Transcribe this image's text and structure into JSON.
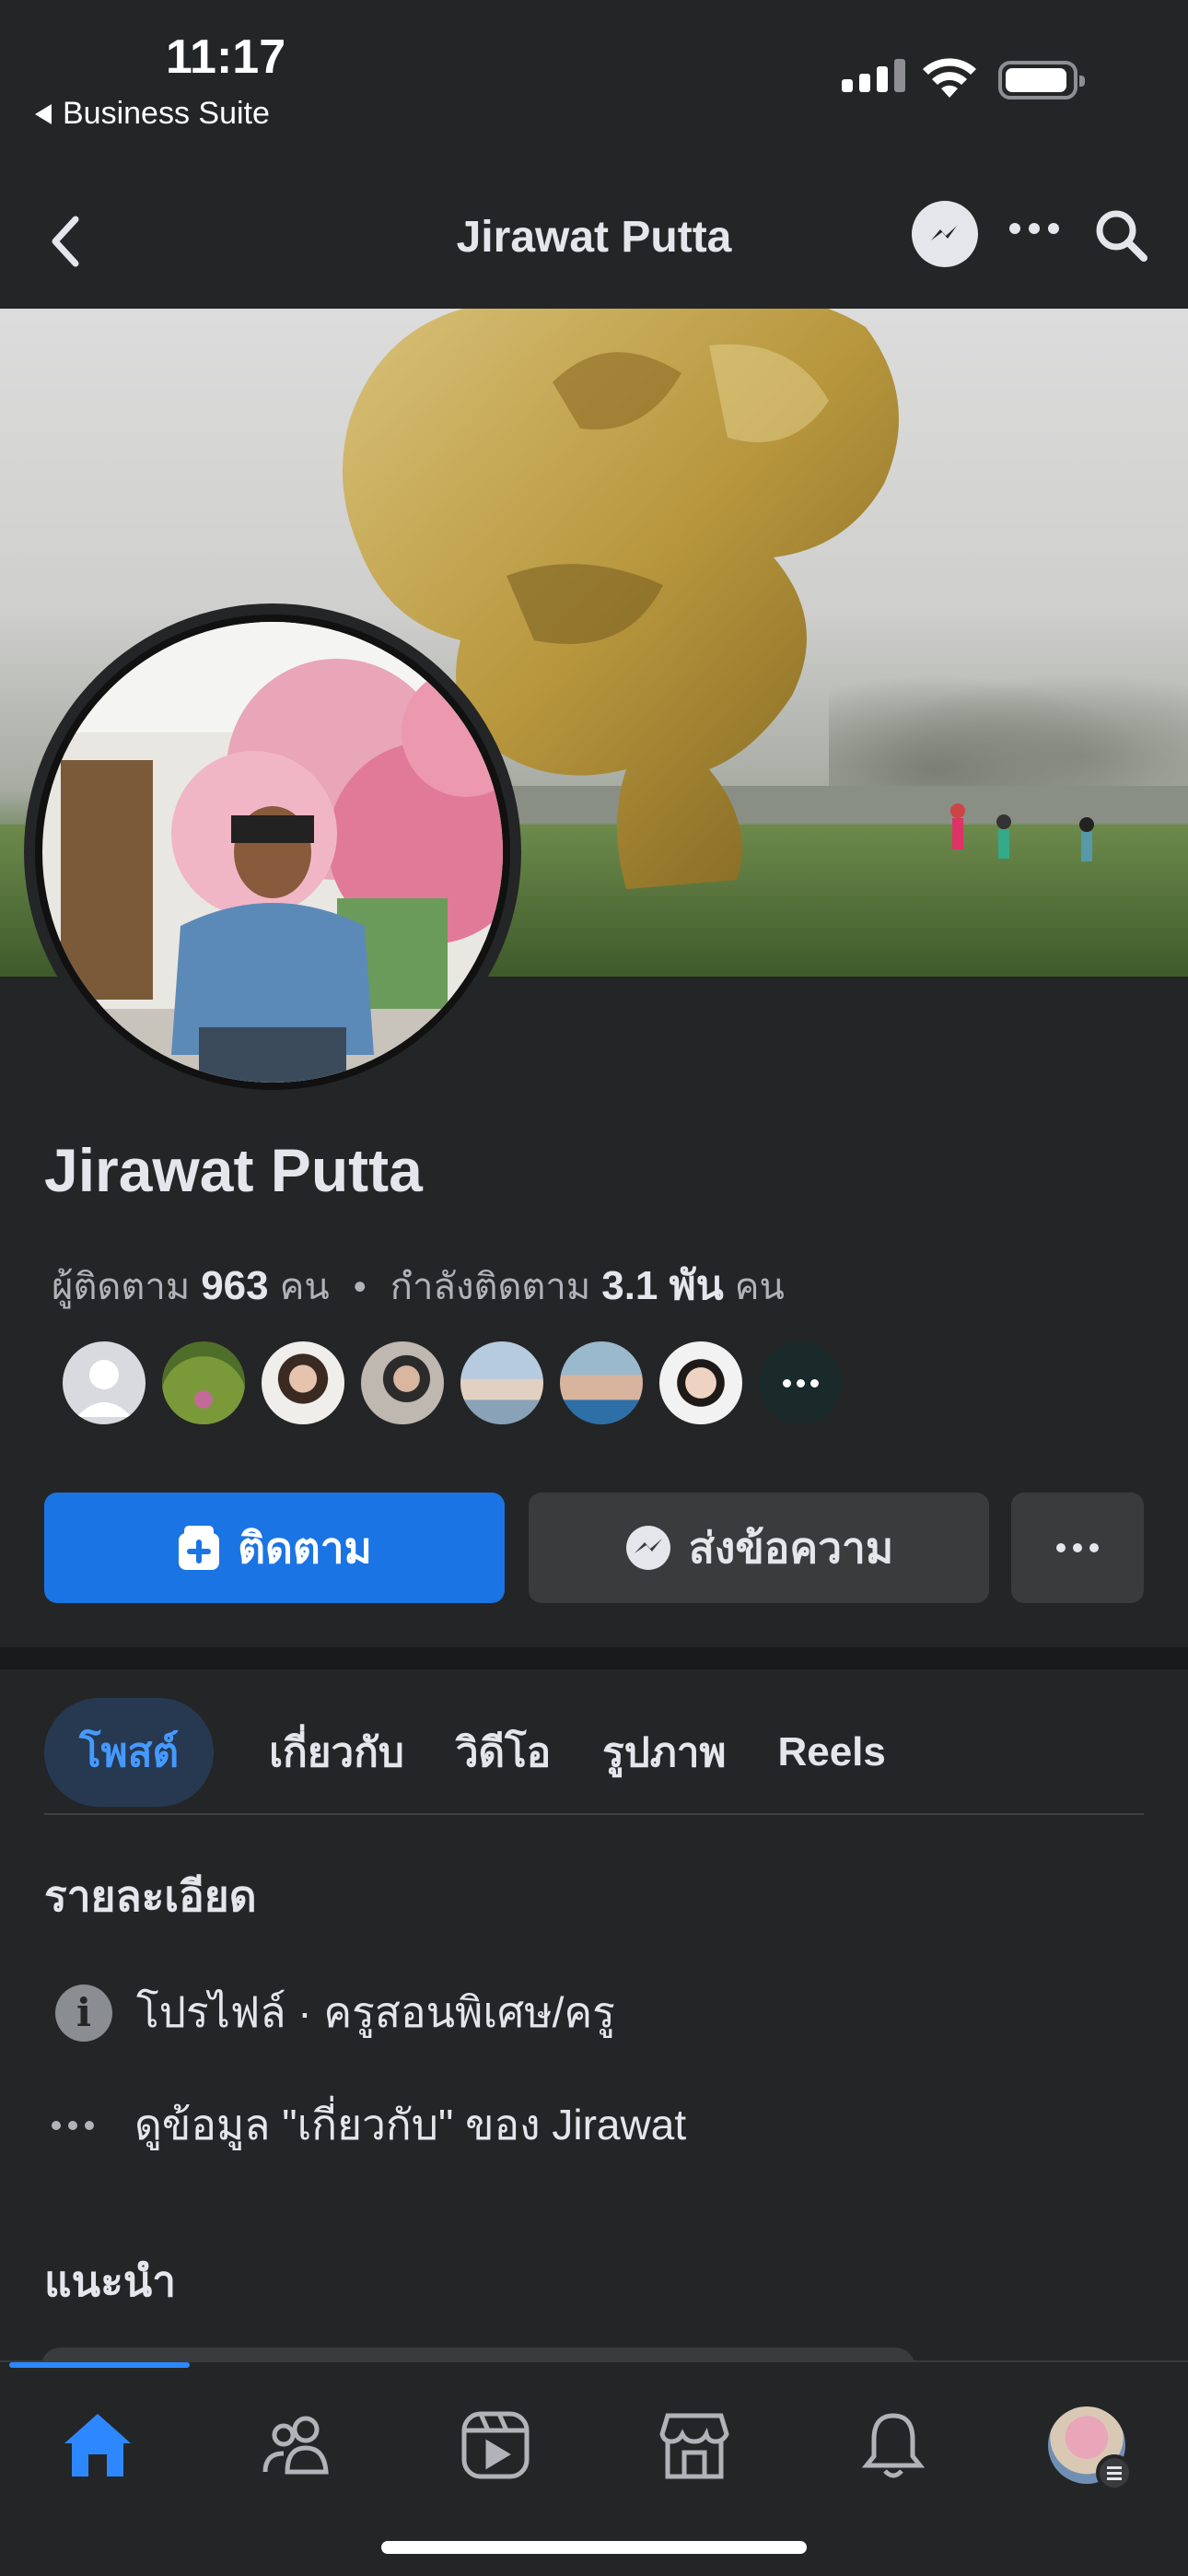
{
  "status_bar": {
    "time": "11:17",
    "back_app": "Business Suite"
  },
  "nav": {
    "title": "Jirawat Putta",
    "icons": [
      "back-chevron-icon",
      "messenger-icon",
      "more-dots-icon",
      "search-icon"
    ]
  },
  "profile": {
    "name": "Jirawat Putta",
    "followers_label": "ผู้ติดตาม",
    "followers_count": "963",
    "followers_unit": "คน",
    "following_label": "กำลังติดตาม",
    "following_count": "3.1 พัน",
    "following_unit": "คน",
    "follower_avatars": [
      "avatar-placeholder",
      "avatar-1",
      "avatar-2",
      "avatar-3",
      "avatar-4",
      "avatar-5",
      "avatar-6",
      "avatar-more"
    ]
  },
  "actions": {
    "follow": "ติดตาม",
    "message": "ส่งข้อความ",
    "more": "more-dots-icon"
  },
  "tabs": [
    "โพสต์",
    "เกี่ยวกับ",
    "วิดีโอ",
    "รูปภาพ",
    "Reels"
  ],
  "active_tab": "โพสต์",
  "details": {
    "title": "รายละเอียด",
    "profile_line": "โปรไฟล์ · ครูสอนพิเศษ/ครู",
    "about_line": "ดูข้อมูล \"เกี่ยวกับ\" ของ Jirawat"
  },
  "recommend": {
    "title": "แนะนำ"
  },
  "bottom_nav": [
    "home-icon",
    "friends-icon",
    "video-icon",
    "marketplace-icon",
    "notifications-icon",
    "profile-menu-icon"
  ],
  "colors": {
    "accent": "#1b74e4",
    "background": "#242526",
    "active_tab_bg": "#263951",
    "active_tab_text": "#4599ff"
  }
}
